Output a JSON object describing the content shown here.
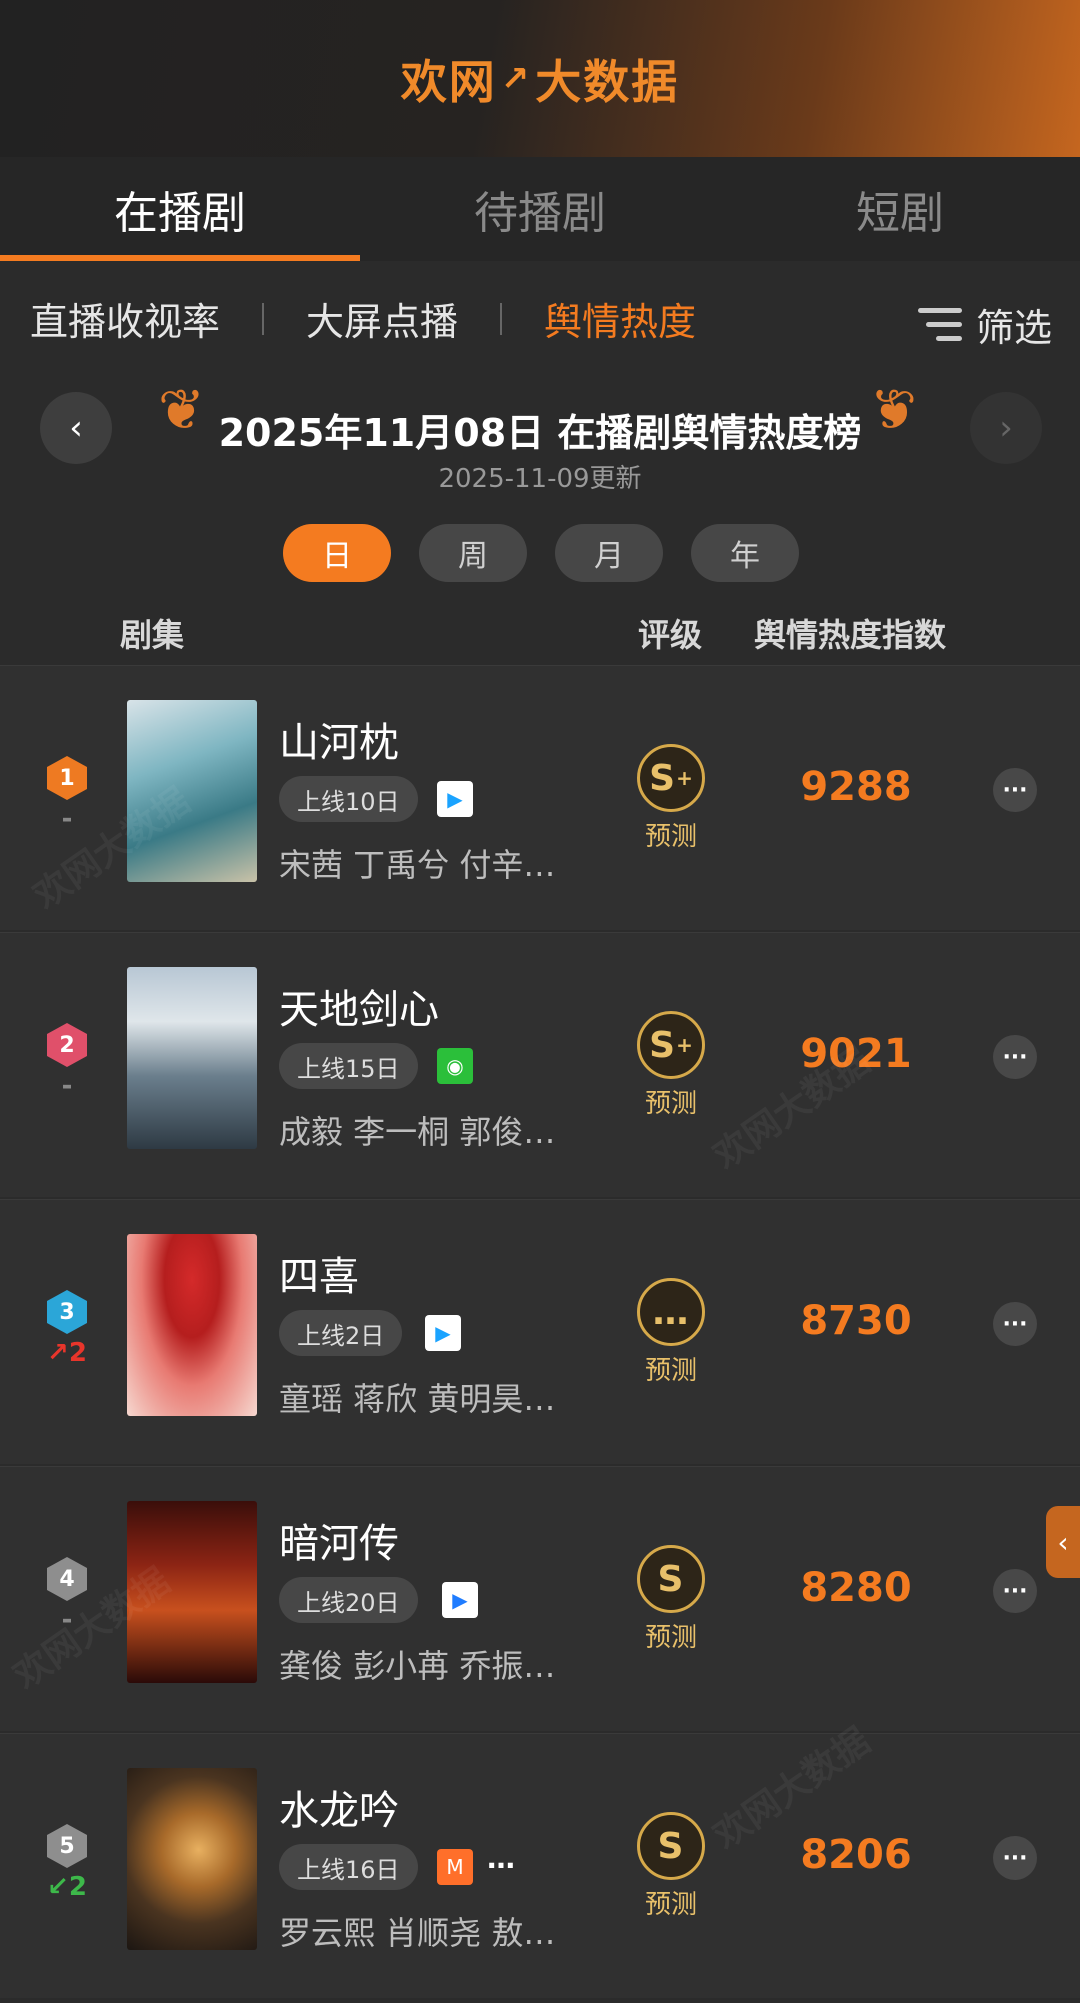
{
  "header": {
    "logo": "欢网",
    "logo_mark": "↗",
    "logo_suffix": "大数据"
  },
  "tabs": [
    "在播剧",
    "待播剧",
    "短剧"
  ],
  "subtabs": [
    "直播收视率",
    "大屏点播",
    "舆情热度"
  ],
  "filter_label": "筛选",
  "title": "2025年11月08日 在播剧舆情热度榜",
  "updated": "2025-11-09更新",
  "periods": [
    "日",
    "周",
    "月",
    "年"
  ],
  "columns": {
    "show": "剧集",
    "grade": "评级",
    "index": "舆情热度指数"
  },
  "rows": [
    {
      "rank": "1",
      "change": "-",
      "name": "山河枕",
      "days": "上线10日",
      "platform_icon": "tencent-video-icon",
      "cast": "宋茜 丁禹兮 付辛…",
      "grade": "S",
      "grade_plus": "+",
      "grade_label": "预测",
      "score": "9288"
    },
    {
      "rank": "2",
      "change": "-",
      "name": "天地剑心",
      "days": "上线15日",
      "platform_icon": "iqiyi-icon",
      "cast": "成毅 李一桐 郭俊…",
      "grade": "S",
      "grade_plus": "+",
      "grade_label": "预测",
      "score": "9021"
    },
    {
      "rank": "3",
      "change": "↗2",
      "name": "四喜",
      "days": "上线2日",
      "platform_icon": "tencent-video-icon",
      "cast": "童瑶 蒋欣 黄明昊…",
      "grade": "…",
      "grade_plus": "",
      "grade_label": "预测",
      "score": "8730"
    },
    {
      "rank": "4",
      "change": "-",
      "name": "暗河传",
      "days": "上线20日",
      "platform_icon": "youku-icon",
      "cast": "龚俊 彭小苒 乔振…",
      "grade": "S",
      "grade_plus": "",
      "grade_label": "预测",
      "score": "8280"
    },
    {
      "rank": "5",
      "change": "↙2",
      "name": "水龙吟",
      "days": "上线16日",
      "platform_icon": "mango-tv-icon",
      "platform_more": "…",
      "cast": "罗云熙 肖顺尧 敖…",
      "grade": "S",
      "grade_plus": "",
      "grade_label": "预测",
      "score": "8206"
    }
  ],
  "watermark": "欢网大数据",
  "colors": {
    "accent": "#f47b20",
    "gold": "#e8c06a",
    "up": "#e8352b",
    "down": "#3db84a"
  }
}
